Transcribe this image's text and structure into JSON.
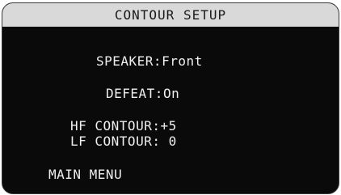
{
  "screen": {
    "title": "CONTOUR SETUP"
  },
  "menu": {
    "speaker": {
      "label": "SPEAKER:",
      "value": "Front"
    },
    "defeat": {
      "label": "DEFEAT:",
      "value": "On"
    },
    "hf_contour": {
      "label": "HF CONTOUR:",
      "value": "+5"
    },
    "lf_contour": {
      "label": "LF CONTOUR:",
      "value": " 0"
    },
    "main_menu": {
      "label": "MAIN MENU"
    }
  },
  "colors": {
    "screen_bg": "#0a0a0a",
    "title_bg": "#d9d9d9",
    "text": "#efefef"
  }
}
